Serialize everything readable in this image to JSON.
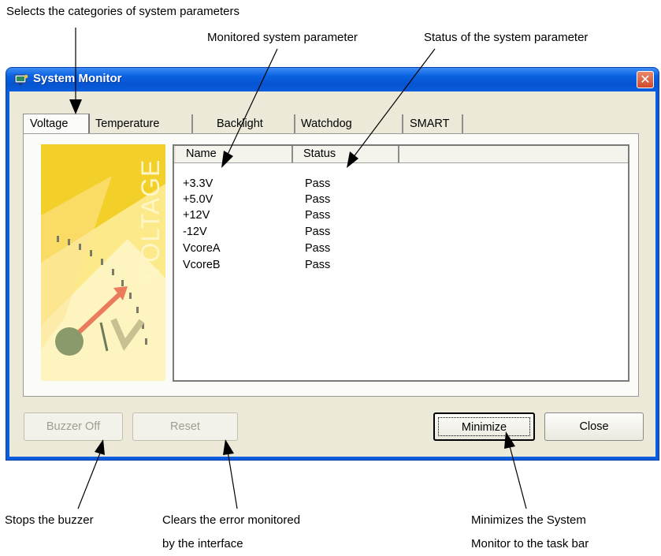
{
  "annotations": {
    "tabs_callout": "Selects the categories of system parameters",
    "param_callout": "Monitored system parameter",
    "status_callout": "Status of the system parameter",
    "buzzer_callout": "Stops the buzzer",
    "reset_callout_line1": "Clears the error monitored",
    "reset_callout_line2": "by the interface",
    "minimize_callout_line1": "Minimizes the System",
    "minimize_callout_line2": "Monitor to the task bar"
  },
  "window": {
    "title": "System Monitor",
    "close_symbol": "✕"
  },
  "tabs": [
    {
      "label": "Voltage",
      "active": true
    },
    {
      "label": "Temperature",
      "active": false
    },
    {
      "label": "Backlight",
      "active": false
    },
    {
      "label": "Watchdog",
      "active": false
    },
    {
      "label": "SMART",
      "active": false
    }
  ],
  "image": {
    "caption": "VOLTAGE",
    "accent_colors": [
      "#f6d83a",
      "#fbeea0",
      "#e87d5a",
      "#8b9a6a"
    ]
  },
  "list": {
    "columns": [
      "Name",
      "Status"
    ],
    "rows": [
      {
        "name": "+3.3V",
        "status": "Pass"
      },
      {
        "name": "+5.0V",
        "status": "Pass"
      },
      {
        "name": "+12V",
        "status": "Pass"
      },
      {
        "name": "-12V",
        "status": "Pass"
      },
      {
        "name": "VcoreA",
        "status": "Pass"
      },
      {
        "name": "VcoreB",
        "status": "Pass"
      }
    ]
  },
  "buttons": {
    "buzzer_off": "Buzzer Off",
    "reset": "Reset",
    "minimize": "Minimize",
    "close": "Close"
  },
  "colors": {
    "titlebar": "#0a5ddc",
    "client": "#ece9d8",
    "disabled_text": "#9e9e8e"
  }
}
